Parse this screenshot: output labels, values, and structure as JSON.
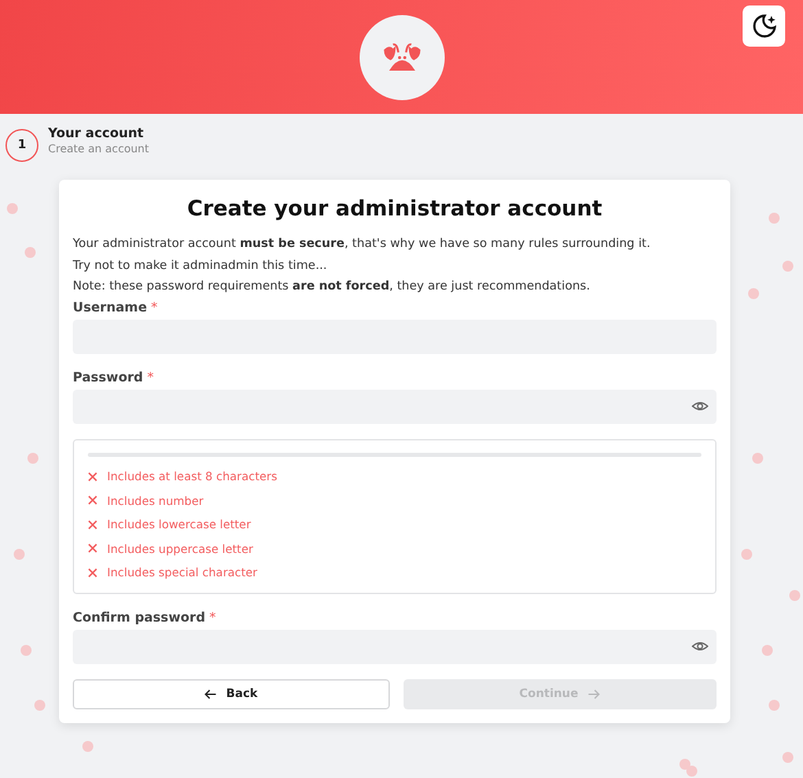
{
  "steps": [
    {
      "number": "1",
      "title": "Your account",
      "subtitle": "Create an account",
      "selected": true
    }
  ],
  "form": {
    "title": "Create your administrator account",
    "intro": [
      "Your administrator account **must be secure**, that's why we have so many rules surrounding it.",
      "Try not to make it adminadmin this time...",
      "Note: these password requirements **are not forced**, they are just recommendations."
    ],
    "fields": [
      {
        "kind": "text",
        "label": "Username",
        "required_mark": "*"
      },
      {
        "kind": "password",
        "label": "Password",
        "required_mark": "*",
        "strength": {
          "level": 0,
          "requirements": [
            {
              "text": "Includes at least 8 characters",
              "met": false
            },
            {
              "text": "Includes number",
              "met": false
            },
            {
              "text": "Includes lowercase letter",
              "met": false
            },
            {
              "text": "Includes uppercase letter",
              "met": false
            },
            {
              "text": "Includes special character",
              "met": false
            }
          ]
        }
      },
      {
        "kind": "password",
        "label": "Confirm password",
        "required_mark": "*"
      }
    ],
    "buttons": [
      {
        "kind": "back",
        "label": "Back",
        "disabled": false
      },
      {
        "kind": "continue",
        "label": "Continue",
        "disabled": true
      }
    ]
  }
}
